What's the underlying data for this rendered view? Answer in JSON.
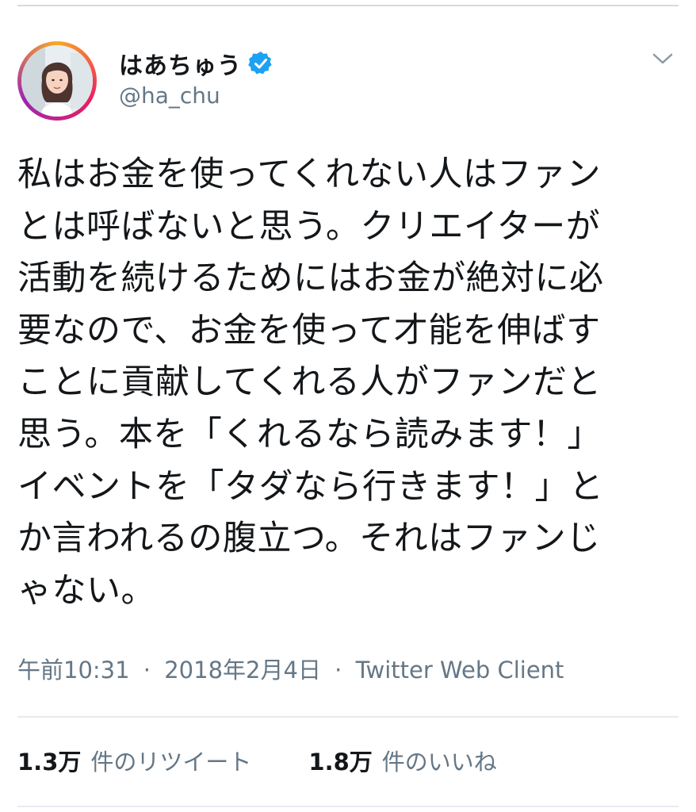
{
  "tweet": {
    "author": {
      "display_name": "はあちゅう",
      "handle": "@ha_chu",
      "verified": true
    },
    "text_lines": [
      "私はお金を使ってくれない人はファン",
      "とは呼ばないと思う。クリエイターが",
      "活動を続けるためにはお金が絶対に必",
      "要なので、お金を使って才能を伸ばす",
      "ことに貢献してくれる人がファンだと",
      "思う。本を「くれるなら読みます！」",
      "イベントを「タダなら行きます！」と",
      "か言われるの腹立つ。それはファンじ",
      "ゃない。"
    ],
    "time": "午前10:31",
    "date": "2018年2月4日",
    "source": "Twitter Web Client",
    "separator": "·",
    "retweets": {
      "count": "1.3万",
      "label": "件のリツイート"
    },
    "likes": {
      "count": "1.8万",
      "label": "件のいいね"
    }
  },
  "colors": {
    "text_primary": "#14171a",
    "text_secondary": "#657786",
    "verified_blue": "#1da1f2",
    "divider": "#e6ecf0"
  },
  "icons": {
    "verified": "verified-badge-icon",
    "menu": "chevron-down-icon"
  }
}
